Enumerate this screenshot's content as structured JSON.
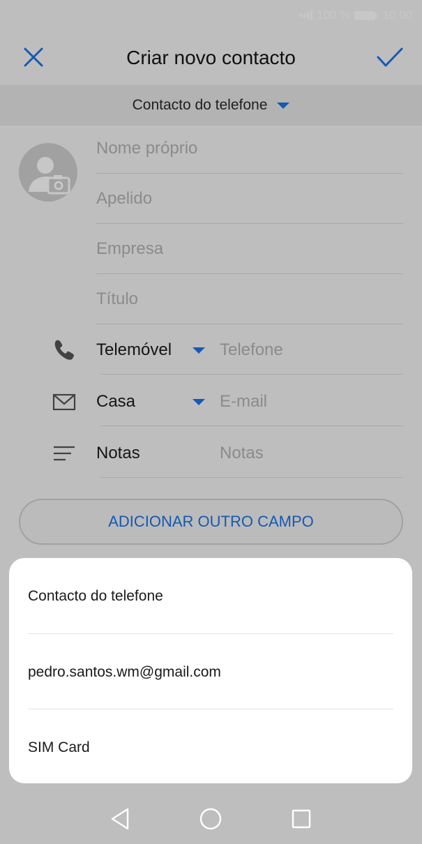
{
  "status_bar": {
    "battery_text": "100 %",
    "time": "10:00"
  },
  "header": {
    "title": "Criar novo contacto",
    "close_icon": "close-icon",
    "confirm_icon": "check-icon",
    "accent_color": "#1a73e8"
  },
  "account_selector": {
    "label": "Contacto do telefone"
  },
  "form": {
    "first_name_placeholder": "Nome próprio",
    "last_name_placeholder": "Apelido",
    "company_placeholder": "Empresa",
    "title_placeholder": "Título",
    "phone": {
      "type_label": "Telemóvel",
      "placeholder": "Telefone",
      "icon": "phone-icon"
    },
    "email": {
      "type_label": "Casa",
      "placeholder": "E-mail",
      "icon": "mail-icon"
    },
    "notes": {
      "label": "Notas",
      "placeholder": "Notas",
      "icon": "notes-icon"
    },
    "add_field_button": "ADICIONAR OUTRO CAMPO"
  },
  "account_popup": {
    "items": [
      {
        "label": "Contacto do telefone"
      },
      {
        "label": "pedro.santos.wm@gmail.com"
      },
      {
        "label": "SIM Card"
      }
    ]
  },
  "nav_bar": {
    "back_icon": "back-triangle-icon",
    "home_icon": "home-circle-icon",
    "recents_icon": "recents-square-icon"
  }
}
